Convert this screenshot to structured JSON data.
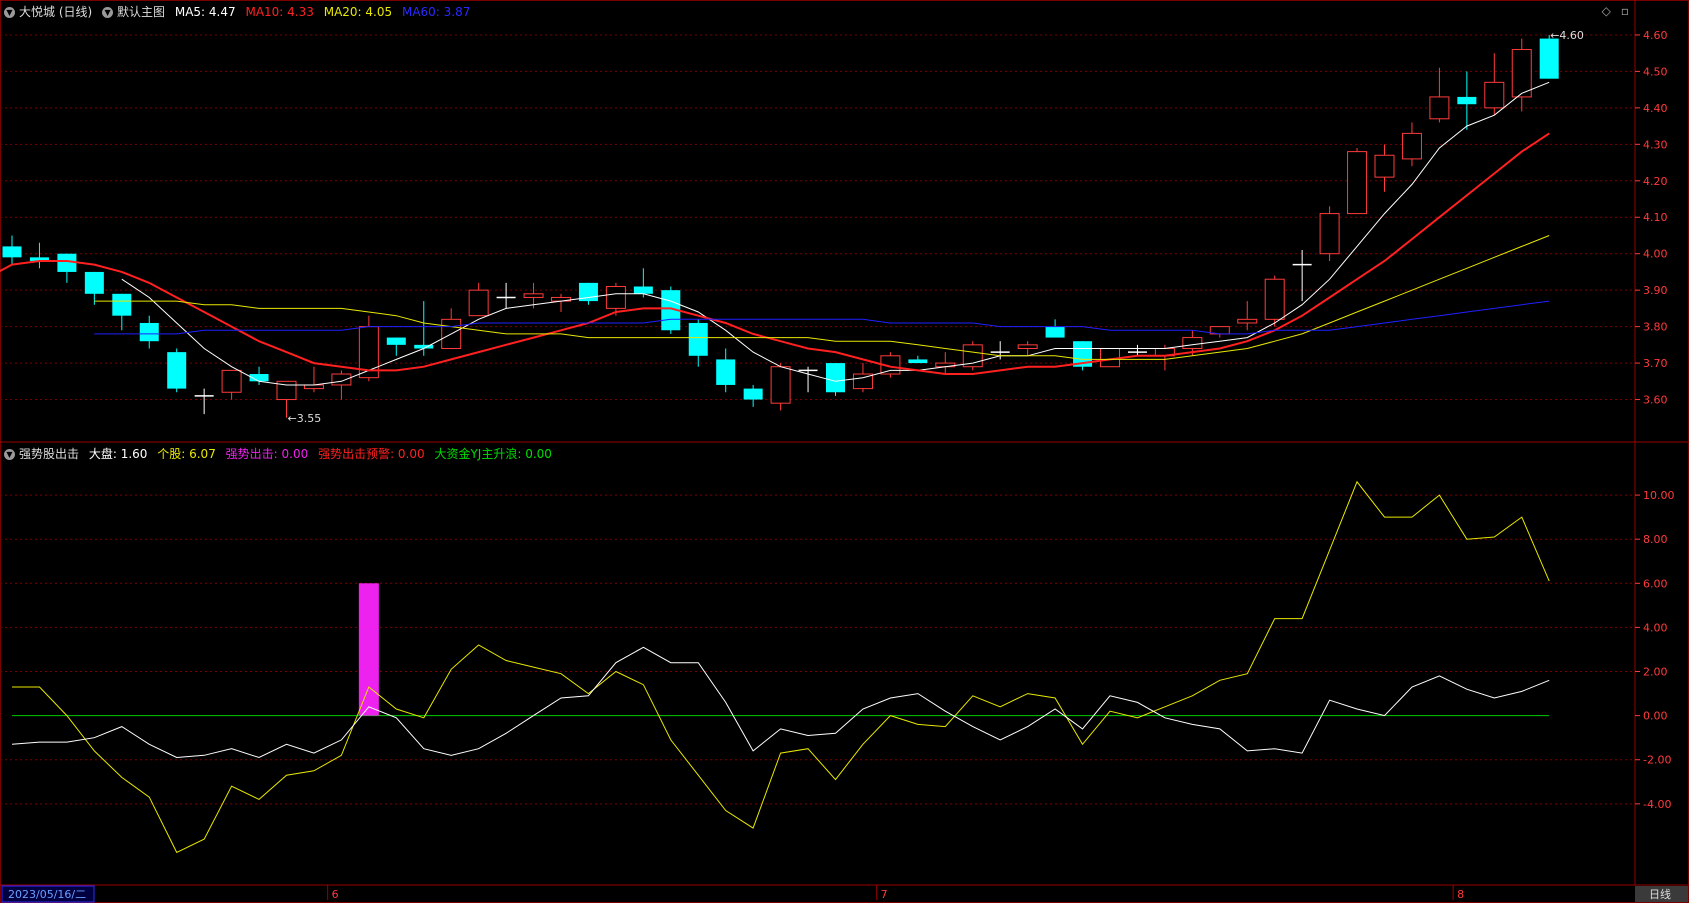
{
  "upper_header": {
    "title": "大悦城 (日线)",
    "main_chart": "默认主图",
    "ma5": "MA5: 4.47",
    "ma10": "MA10: 4.33",
    "ma20": "MA20: 4.05",
    "ma60": "MA60: 3.87"
  },
  "lower_header": {
    "indicator": "强势股出击",
    "dapan": "大盘: 1.60",
    "gegu": "个股: 6.07",
    "qiangshi": "强势出击: 0.00",
    "yujing": "强势出击预警: 0.00",
    "dazijin": "大资金YJ主升浪: 0.00"
  },
  "footer": {
    "date": "2023/05/16/二",
    "period": "日线"
  },
  "colors": {
    "up": "#ff3b3b",
    "down": "#00ffff",
    "ma5": "#ffffff",
    "ma10": "#ff2020",
    "ma20": "#e8e800",
    "ma60": "#2020ff",
    "grid": "#7a0000",
    "axis_text": "#ff3b3b",
    "zero_line": "#00cc00",
    "signal_bar": "#ee22ee",
    "gegu_line": "#e8e800",
    "dapan_line": "#ffffff",
    "magenta_text": "#ee22ee",
    "green_text": "#00dd00"
  },
  "chart_data": [
    {
      "type": "candlestick",
      "title": "大悦城 (日线)",
      "ylim": [
        3.5,
        4.63
      ],
      "yticks": [
        "4.60",
        "4.50",
        "4.40",
        "4.30",
        "4.20",
        "4.10",
        "4.00",
        "3.90",
        "3.80",
        "3.70",
        "3.60"
      ],
      "x_month_labels": [
        {
          "index": 12,
          "label": "6"
        },
        {
          "index": 32,
          "label": "7"
        },
        {
          "index": 53,
          "label": "8"
        }
      ],
      "annotations": [
        {
          "index": 10,
          "value": 3.55,
          "text": "←3.55"
        },
        {
          "index": 56,
          "value": 4.6,
          "text": "←4.60"
        }
      ],
      "candles": [
        [
          4.02,
          4.05,
          3.97,
          3.99
        ],
        [
          3.99,
          4.03,
          3.96,
          3.98
        ],
        [
          4.0,
          4.0,
          3.92,
          3.95
        ],
        [
          3.95,
          3.95,
          3.86,
          3.89
        ],
        [
          3.89,
          3.89,
          3.79,
          3.83
        ],
        [
          3.81,
          3.83,
          3.74,
          3.76
        ],
        [
          3.73,
          3.74,
          3.62,
          3.63
        ],
        [
          3.61,
          3.63,
          3.56,
          3.61
        ],
        [
          3.62,
          3.68,
          3.6,
          3.68
        ],
        [
          3.67,
          3.69,
          3.64,
          3.65
        ],
        [
          3.6,
          3.65,
          3.55,
          3.65
        ],
        [
          3.63,
          3.69,
          3.62,
          3.64
        ],
        [
          3.64,
          3.68,
          3.6,
          3.67
        ],
        [
          3.66,
          3.83,
          3.65,
          3.8
        ],
        [
          3.77,
          3.77,
          3.72,
          3.75
        ],
        [
          3.75,
          3.87,
          3.72,
          3.74
        ],
        [
          3.74,
          3.85,
          3.74,
          3.82
        ],
        [
          3.83,
          3.92,
          3.83,
          3.9
        ],
        [
          3.88,
          3.92,
          3.85,
          3.88
        ],
        [
          3.88,
          3.92,
          3.85,
          3.89
        ],
        [
          3.87,
          3.89,
          3.84,
          3.88
        ],
        [
          3.92,
          3.92,
          3.86,
          3.87
        ],
        [
          3.85,
          3.92,
          3.83,
          3.91
        ],
        [
          3.91,
          3.96,
          3.88,
          3.89
        ],
        [
          3.9,
          3.91,
          3.78,
          3.79
        ],
        [
          3.81,
          3.82,
          3.69,
          3.72
        ],
        [
          3.71,
          3.74,
          3.62,
          3.64
        ],
        [
          3.63,
          3.64,
          3.58,
          3.6
        ],
        [
          3.59,
          3.7,
          3.57,
          3.69
        ],
        [
          3.68,
          3.69,
          3.62,
          3.68
        ],
        [
          3.7,
          3.7,
          3.61,
          3.62
        ],
        [
          3.63,
          3.7,
          3.62,
          3.67
        ],
        [
          3.67,
          3.73,
          3.66,
          3.72
        ],
        [
          3.71,
          3.72,
          3.7,
          3.7
        ],
        [
          3.69,
          3.73,
          3.67,
          3.7
        ],
        [
          3.69,
          3.76,
          3.68,
          3.75
        ],
        [
          3.73,
          3.76,
          3.71,
          3.73
        ],
        [
          3.74,
          3.76,
          3.72,
          3.75
        ],
        [
          3.8,
          3.82,
          3.77,
          3.77
        ],
        [
          3.76,
          3.76,
          3.68,
          3.69
        ],
        [
          3.69,
          3.74,
          3.69,
          3.74
        ],
        [
          3.73,
          3.75,
          3.72,
          3.73
        ],
        [
          3.72,
          3.75,
          3.68,
          3.74
        ],
        [
          3.74,
          3.79,
          3.72,
          3.77
        ],
        [
          3.78,
          3.8,
          3.77,
          3.8
        ],
        [
          3.81,
          3.87,
          3.79,
          3.82
        ],
        [
          3.82,
          3.94,
          3.8,
          3.93
        ],
        [
          3.97,
          4.01,
          3.87,
          3.97
        ],
        [
          4.0,
          4.13,
          3.98,
          4.11
        ],
        [
          4.11,
          4.29,
          4.11,
          4.28
        ],
        [
          4.21,
          4.3,
          4.17,
          4.27
        ],
        [
          4.26,
          4.36,
          4.24,
          4.33
        ],
        [
          4.37,
          4.51,
          4.36,
          4.43
        ],
        [
          4.43,
          4.5,
          4.34,
          4.41
        ],
        [
          4.4,
          4.55,
          4.38,
          4.47
        ],
        [
          4.43,
          4.59,
          4.39,
          4.56
        ],
        [
          4.59,
          4.6,
          4.48,
          4.48
        ]
      ],
      "series": [
        {
          "name": "MA5",
          "values": [
            null,
            null,
            null,
            null,
            3.93,
            3.88,
            3.81,
            3.74,
            3.69,
            3.65,
            3.64,
            3.64,
            3.65,
            3.68,
            3.71,
            3.74,
            3.78,
            3.82,
            3.85,
            3.86,
            3.87,
            3.88,
            3.89,
            3.89,
            3.87,
            3.84,
            3.79,
            3.73,
            3.69,
            3.67,
            3.65,
            3.66,
            3.68,
            3.68,
            3.69,
            3.7,
            3.72,
            3.72,
            3.74,
            3.74,
            3.74,
            3.74,
            3.74,
            3.75,
            3.76,
            3.77,
            3.81,
            3.86,
            3.93,
            4.02,
            4.11,
            4.19,
            4.29,
            4.35,
            4.38,
            4.44,
            4.47
          ]
        },
        {
          "name": "MA10",
          "values": [
            3.93,
            3.97,
            3.98,
            3.98,
            3.97,
            3.95,
            3.92,
            3.88,
            3.84,
            3.8,
            3.76,
            3.73,
            3.7,
            3.69,
            3.68,
            3.68,
            3.69,
            3.71,
            3.73,
            3.75,
            3.77,
            3.79,
            3.81,
            3.84,
            3.85,
            3.85,
            3.83,
            3.81,
            3.78,
            3.76,
            3.74,
            3.73,
            3.71,
            3.69,
            3.68,
            3.67,
            3.67,
            3.68,
            3.69,
            3.69,
            3.7,
            3.71,
            3.72,
            3.72,
            3.73,
            3.74,
            3.76,
            3.79,
            3.83,
            3.88,
            3.93,
            3.98,
            4.04,
            4.1,
            4.16,
            4.22,
            4.28,
            4.33
          ]
        },
        {
          "name": "MA20",
          "values": [
            3.87,
            3.87,
            3.87,
            3.87,
            3.86,
            3.86,
            3.85,
            3.85,
            3.85,
            3.85,
            3.84,
            3.83,
            3.81,
            3.8,
            3.79,
            3.78,
            3.78,
            3.78,
            3.77,
            3.77,
            3.77,
            3.77,
            3.77,
            3.77,
            3.77,
            3.77,
            3.77,
            3.76,
            3.76,
            3.76,
            3.75,
            3.74,
            3.73,
            3.72,
            3.72,
            3.72,
            3.71,
            3.71,
            3.71,
            3.71,
            3.72,
            3.73,
            3.74,
            3.76,
            3.78,
            3.81,
            3.84,
            3.87,
            3.9,
            3.93,
            3.96,
            3.99,
            4.02,
            4.05
          ]
        },
        {
          "name": "MA60",
          "values": [
            3.78,
            3.78,
            3.78,
            3.78,
            3.79,
            3.79,
            3.79,
            3.79,
            3.79,
            3.79,
            3.8,
            3.8,
            3.8,
            3.8,
            3.81,
            3.81,
            3.81,
            3.81,
            3.81,
            3.81,
            3.81,
            3.82,
            3.82,
            3.82,
            3.82,
            3.82,
            3.82,
            3.82,
            3.82,
            3.81,
            3.81,
            3.81,
            3.81,
            3.8,
            3.8,
            3.8,
            3.8,
            3.79,
            3.79,
            3.79,
            3.79,
            3.78,
            3.78,
            3.79,
            3.79,
            3.79,
            3.8,
            3.81,
            3.82,
            3.83,
            3.84,
            3.85,
            3.86,
            3.87
          ]
        }
      ]
    },
    {
      "type": "line",
      "title": "强势股出击",
      "ylim": [
        -7,
        11.5
      ],
      "yticks": [
        "10.00",
        "8.00",
        "6.00",
        "4.00",
        "2.00",
        "0.00",
        "-2.00",
        "-4.00"
      ],
      "series": [
        {
          "name": "个股",
          "values": [
            1.3,
            1.3,
            0.0,
            -1.6,
            -2.8,
            -3.7,
            -6.2,
            -5.6,
            -3.2,
            -3.8,
            -2.7,
            -2.5,
            -1.8,
            1.3,
            0.3,
            -0.1,
            2.1,
            3.2,
            2.5,
            2.2,
            1.9,
            1.0,
            2.0,
            1.4,
            -1.1,
            -2.7,
            -4.3,
            -5.1,
            -1.7,
            -1.5,
            -2.9,
            -1.3,
            0.0,
            -0.4,
            -0.5,
            0.9,
            0.4,
            1.0,
            0.8,
            -1.3,
            0.2,
            -0.1,
            0.4,
            0.9,
            1.6,
            1.9,
            4.4,
            4.4,
            7.5,
            10.6,
            9.0,
            9.0,
            10.0,
            8.0,
            8.1,
            9.0,
            6.1
          ]
        },
        {
          "name": "大盘",
          "values": [
            -1.3,
            -1.2,
            -1.2,
            -1.0,
            -0.5,
            -1.3,
            -1.9,
            -1.8,
            -1.5,
            -1.9,
            -1.3,
            -1.7,
            -1.1,
            0.4,
            -0.1,
            -1.5,
            -1.8,
            -1.5,
            -0.8,
            0.0,
            0.8,
            0.9,
            2.4,
            3.1,
            2.4,
            2.4,
            0.6,
            -1.6,
            -0.6,
            -0.9,
            -0.8,
            0.3,
            0.8,
            1.0,
            0.2,
            -0.5,
            -1.1,
            -0.5,
            0.3,
            -0.6,
            0.9,
            0.6,
            -0.1,
            -0.4,
            -0.6,
            -1.6,
            -1.5,
            -1.7,
            0.7,
            0.3,
            0.0,
            1.3,
            1.8,
            1.2,
            0.8,
            1.1,
            1.6
          ]
        }
      ],
      "bars": [
        {
          "name": "强势出击",
          "index": 13,
          "value": 6.0
        }
      ],
      "zero_line": 0
    }
  ]
}
